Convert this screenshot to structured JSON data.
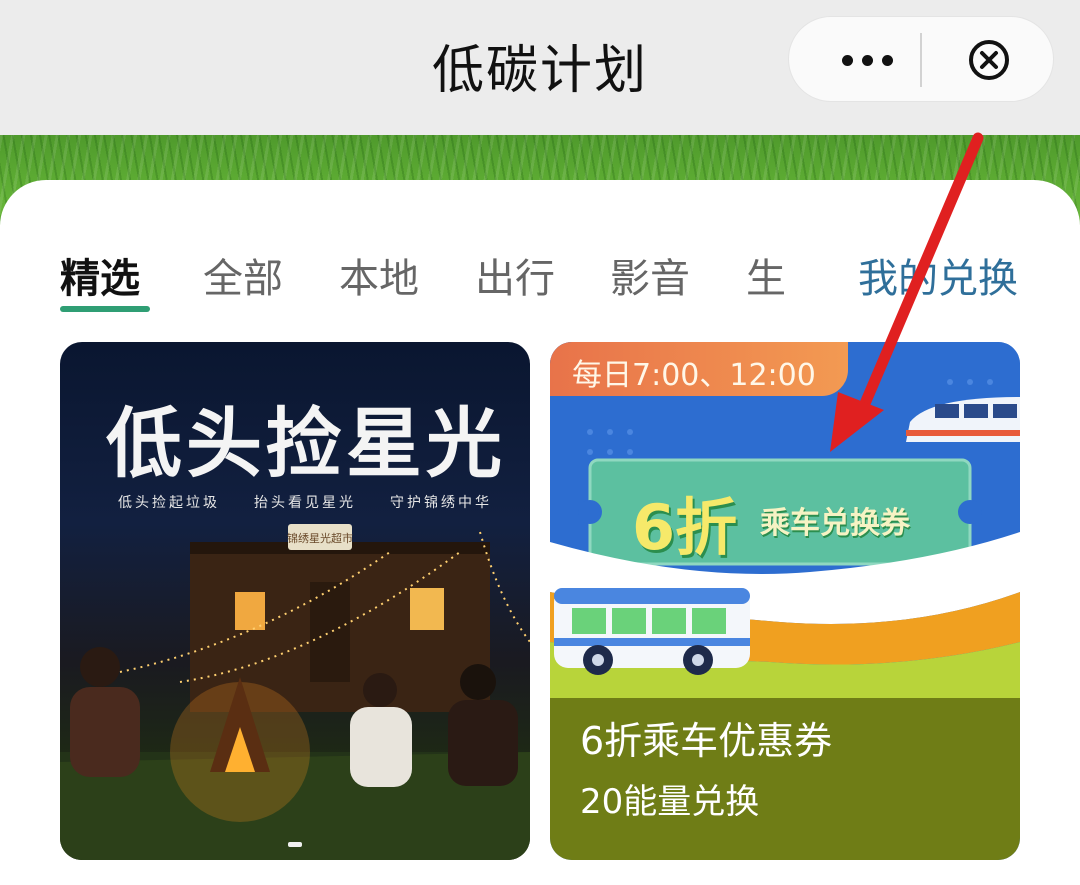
{
  "header": {
    "title": "低碳计划",
    "more_icon": "more-dots-icon",
    "close_icon": "close-circle-icon"
  },
  "tabs": [
    {
      "label": "精选",
      "active": true
    },
    {
      "label": "全部",
      "active": false
    },
    {
      "label": "本地",
      "active": false
    },
    {
      "label": "出行",
      "active": false
    },
    {
      "label": "影音",
      "active": false
    },
    {
      "label": "生",
      "active": false
    }
  ],
  "my_exchange": "我的兑换",
  "cards": [
    {
      "title": "低头捡星光",
      "subtitle": "低头捡起垃圾　　抬头看见星光　　守护锦绣中华",
      "sign": "锦绣星光超市"
    },
    {
      "time_badge": "每日7:00、12:00",
      "coupon_big": "6折",
      "coupon_small": "乘车兑换券",
      "name": "6折乘车优惠券",
      "price": "20能量兑换"
    }
  ],
  "colors": {
    "accent_green": "#2f9e74",
    "exchange_link": "#2f6f9a",
    "arrow_red": "#e02020"
  }
}
